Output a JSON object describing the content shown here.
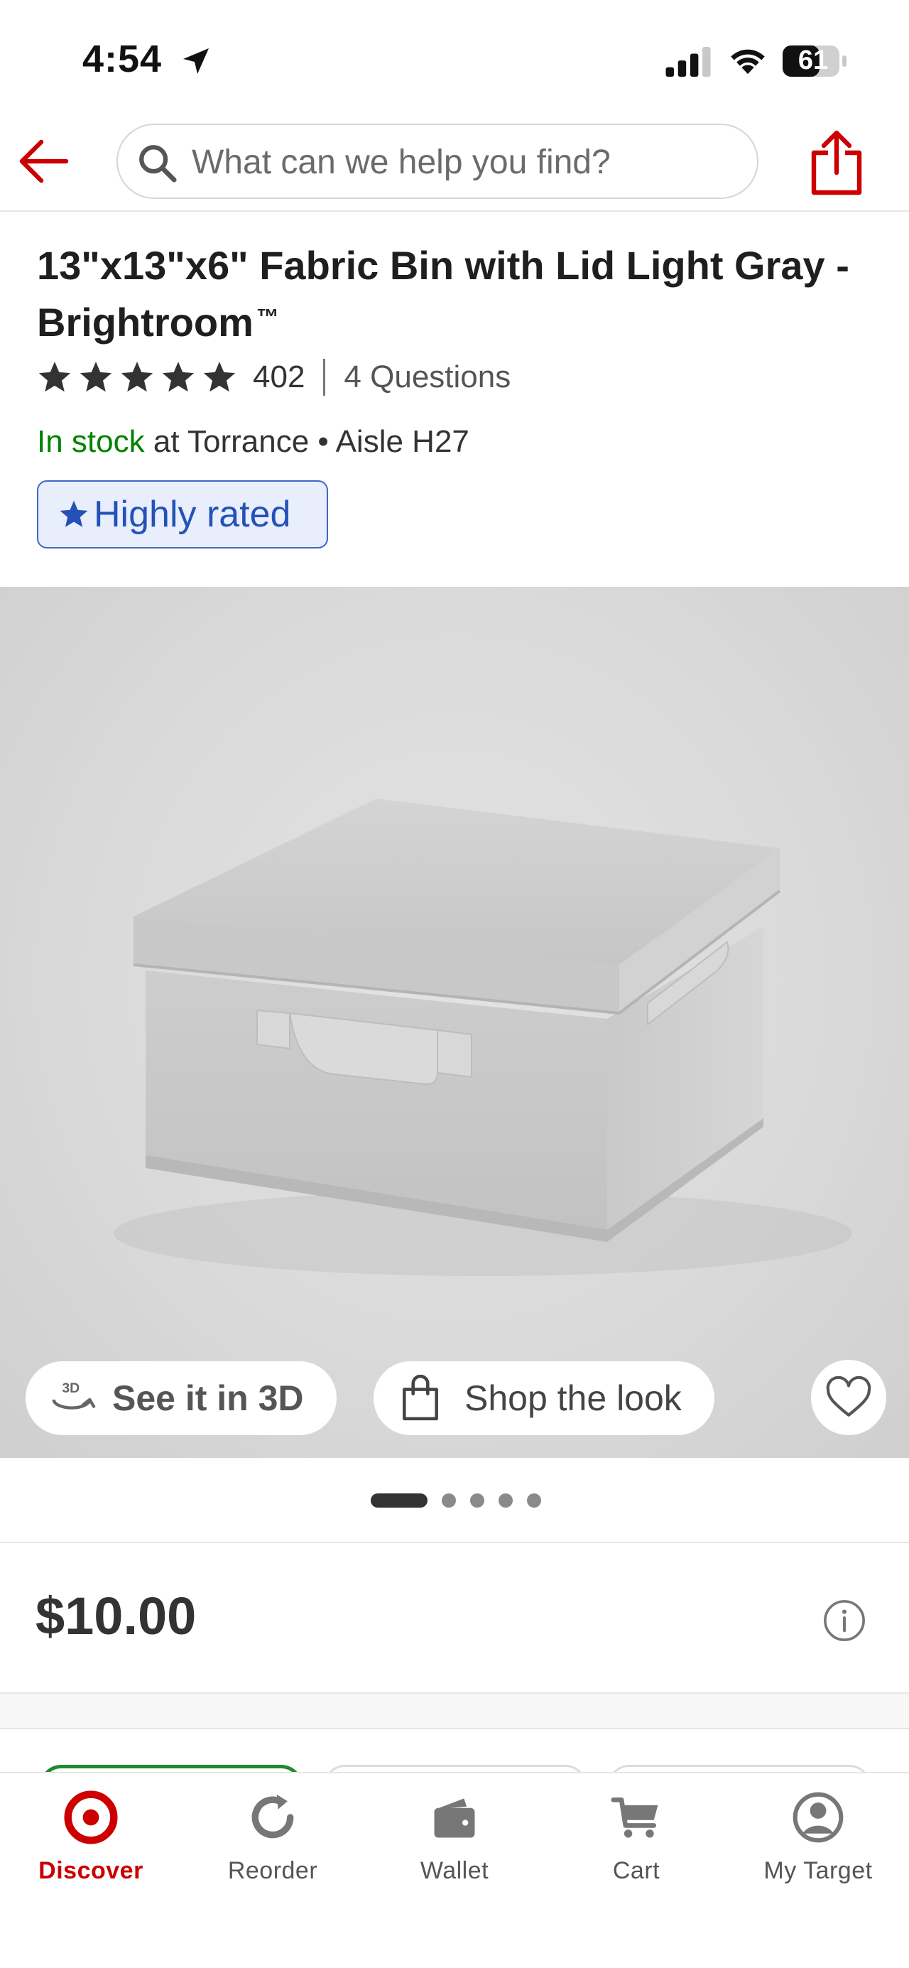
{
  "status_bar": {
    "time": "4:54",
    "battery": "61"
  },
  "header": {
    "search_placeholder": "What can we help you find?"
  },
  "product": {
    "title": "13\"x13\"x6\" Fabric Bin with Lid Light Gray - Brightroom",
    "trademark": "™",
    "rating": 5,
    "rating_count": "402",
    "questions": "4 Questions",
    "stock_status": "In stock",
    "stock_location": " at Torrance • Aisle H27",
    "badge": "Highly rated",
    "image_actions": {
      "view_3d": "See it in 3D",
      "shop_look": "Shop the look"
    },
    "carousel": {
      "total": 5,
      "active": 1
    },
    "price": "$10.00"
  },
  "colors": {
    "brand_red": "#cc0000",
    "in_stock_green": "#008300",
    "badge_blue": "#2451b8"
  },
  "bottom_nav": [
    {
      "label": "Discover",
      "icon": "target-logo-icon",
      "active": true
    },
    {
      "label": "Reorder",
      "icon": "reorder-icon",
      "active": false
    },
    {
      "label": "Wallet",
      "icon": "wallet-icon",
      "active": false
    },
    {
      "label": "Cart",
      "icon": "cart-icon",
      "active": false
    },
    {
      "label": "My Target",
      "icon": "account-icon",
      "active": false
    }
  ]
}
